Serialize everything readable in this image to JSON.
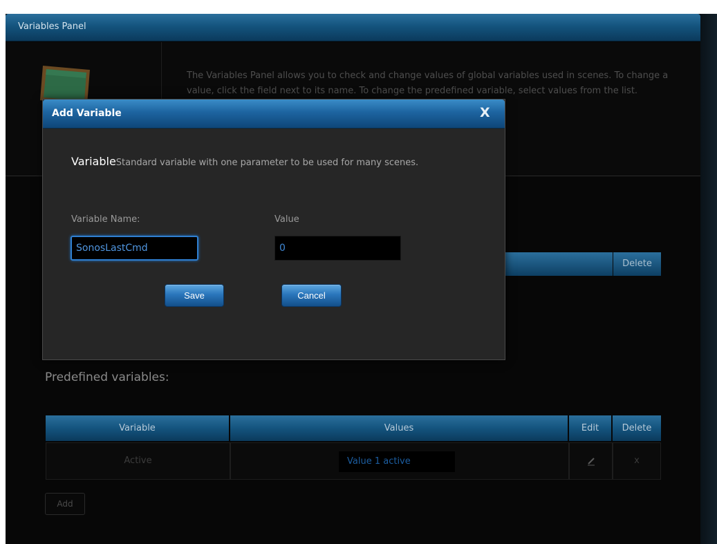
{
  "panel": {
    "title": "Variables Panel",
    "intro_text": "The Variables Panel allows you to check and change values of global variables used in scenes. To change a value, click the field next to its name. To change the predefined variable, select values from the list."
  },
  "custom_table": {
    "delete_header": "Delete"
  },
  "predefined": {
    "title": "Predefined variables:",
    "headers": {
      "variable": "Variable",
      "values": "Values",
      "edit": "Edit",
      "delete": "Delete"
    },
    "rows": [
      {
        "variable": "Active",
        "value": "Value 1 active",
        "delete": "x"
      }
    ],
    "add_label": "Add"
  },
  "modal": {
    "title": "Add Variable",
    "close": "X",
    "desc_title": "Variable",
    "desc_text": "Standard variable with one parameter to be used for many scenes.",
    "name_label": "Variable Name:",
    "name_value": "SonosLastCmd",
    "value_label": "Value",
    "value_value": "0",
    "save_label": "Save",
    "cancel_label": "Cancel"
  },
  "colors": {
    "accent_blue": "#1d64a0",
    "background": "#070707",
    "focus_blue": "#2f7fd0"
  }
}
